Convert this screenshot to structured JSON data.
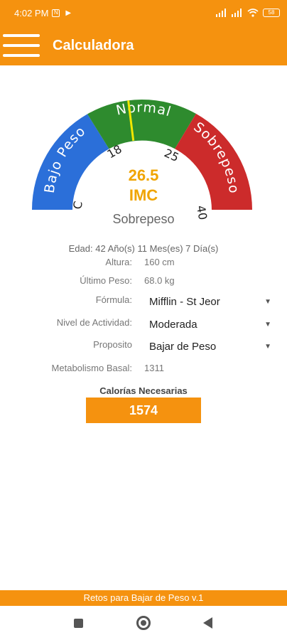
{
  "status": {
    "time": "4:02 PM",
    "badge": "N",
    "battery": "58"
  },
  "app_bar": {
    "title": "Calculadora"
  },
  "gauge": {
    "bmi": 26.5,
    "range": [
      15,
      40
    ],
    "zones": [
      {
        "label": "Bajo Peso",
        "from": 15,
        "to": 18,
        "color": "#2b6fd9"
      },
      {
        "label": "Normal",
        "from": 18,
        "to": 25,
        "color": "#2e8b2e"
      },
      {
        "label": "Sobrepeso",
        "from": 25,
        "to": 40,
        "color": "#cc2b2b"
      }
    ],
    "tick_labels": [
      "C",
      "18",
      "25",
      "40"
    ],
    "needle_color": "#f2e600"
  },
  "result": {
    "value": "26.5",
    "unit": "IMC",
    "status": "Sobrepeso"
  },
  "age_line": "Edad: 42 Año(s) 11 Mes(es) 7 Día(s)",
  "info": {
    "height_label": "Altura:",
    "height_value": "160 cm",
    "weight_label": "Último Peso:",
    "weight_value": "68.0 kg",
    "formula_label": "Fórmula:",
    "formula_value": "Mifflin - St Jeor",
    "activity_label": "Nivel de Actividad:",
    "activity_value": "Moderada",
    "purpose_label": "Proposito",
    "purpose_value": "Bajar de Peso",
    "bmr_label": "Metabolismo Basal:",
    "bmr_value": "1311"
  },
  "calories": {
    "label": "Calorías Necesarias",
    "value": "1574"
  },
  "footer": "Retos para Bajar de Peso v.1"
}
